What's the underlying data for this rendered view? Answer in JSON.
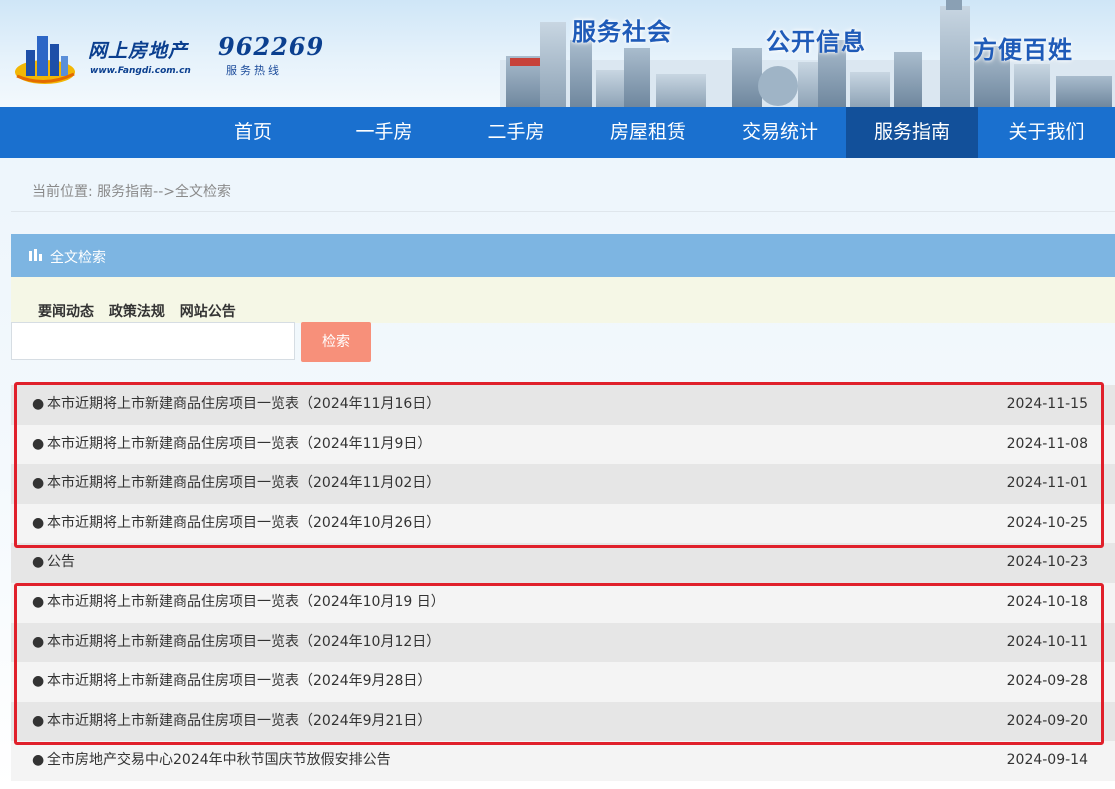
{
  "header": {
    "logo_text": "网上房地产",
    "logo_url": "www.Fangdi.com.cn",
    "hotline_number": "962269",
    "hotline_label": "服务热线",
    "slogans": [
      "服务社会",
      "公开信息",
      "方便百姓"
    ]
  },
  "nav": {
    "items": [
      "首页",
      "一手房",
      "二手房",
      "房屋租赁",
      "交易统计",
      "服务指南",
      "关于我们"
    ],
    "active": "服务指南"
  },
  "breadcrumb": "当前位置: 服务指南-->全文检索",
  "search_panel": {
    "title": "全文检索",
    "categories": [
      "要闻动态",
      "政策法规",
      "网站公告"
    ],
    "input_value": "",
    "button_label": "检索"
  },
  "results": [
    {
      "title": "本市近期将上市新建商品住房项目一览表（2024年11月16日）",
      "date": "2024-11-15"
    },
    {
      "title": "本市近期将上市新建商品住房项目一览表（2024年11月9日）",
      "date": "2024-11-08"
    },
    {
      "title": "本市近期将上市新建商品住房项目一览表（2024年11月02日）",
      "date": "2024-11-01"
    },
    {
      "title": "本市近期将上市新建商品住房项目一览表（2024年10月26日）",
      "date": "2024-10-25"
    },
    {
      "title": "公告",
      "date": "2024-10-23"
    },
    {
      "title": "本市近期将上市新建商品住房项目一览表（2024年10月19 日）",
      "date": "2024-10-18"
    },
    {
      "title": "本市近期将上市新建商品住房项目一览表（2024年10月12日）",
      "date": "2024-10-11"
    },
    {
      "title": "本市近期将上市新建商品住房项目一览表（2024年9月28日）",
      "date": "2024-09-28"
    },
    {
      "title": "本市近期将上市新建商品住房项目一览表（2024年9月21日）",
      "date": "2024-09-20"
    },
    {
      "title": "全市房地产交易中心2024年中秋节国庆节放假安排公告",
      "date": "2024-09-14"
    }
  ],
  "bullet": "●",
  "colors": {
    "nav_bg": "#1a70cf",
    "nav_active": "#12509a",
    "panel_head": "#7db5e2",
    "button": "#f7907a",
    "highlight": "#e0202b"
  }
}
